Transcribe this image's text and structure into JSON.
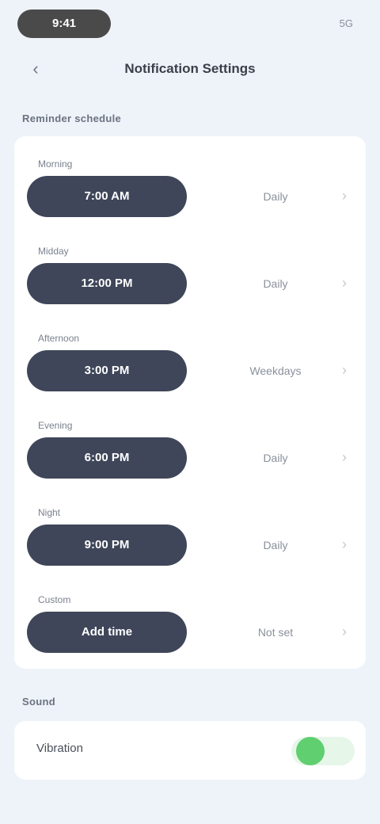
{
  "status_bar": {
    "time": "9:41",
    "right": "5G"
  },
  "nav": {
    "back_icon": "chevron-left-icon",
    "title": "Notification Settings"
  },
  "section_schedule": {
    "label": "Reminder schedule"
  },
  "rows": [
    {
      "label": "Morning",
      "field": "7:00 AM",
      "value": "Daily"
    },
    {
      "label": "Midday",
      "field": "12:00 PM",
      "value": "Daily"
    },
    {
      "label": "Afternoon",
      "field": "3:00 PM",
      "value": "Weekdays"
    },
    {
      "label": "Evening",
      "field": "6:00 PM",
      "value": "Daily"
    },
    {
      "label": "Night",
      "field": "9:00 PM",
      "value": "Daily"
    },
    {
      "label": "Custom",
      "field": "Add time",
      "value": "Not set"
    }
  ],
  "section_sound": {
    "label": "Sound"
  },
  "toggle": {
    "label": "Vibration",
    "state": "on",
    "on_color": "#5fcf6f"
  }
}
